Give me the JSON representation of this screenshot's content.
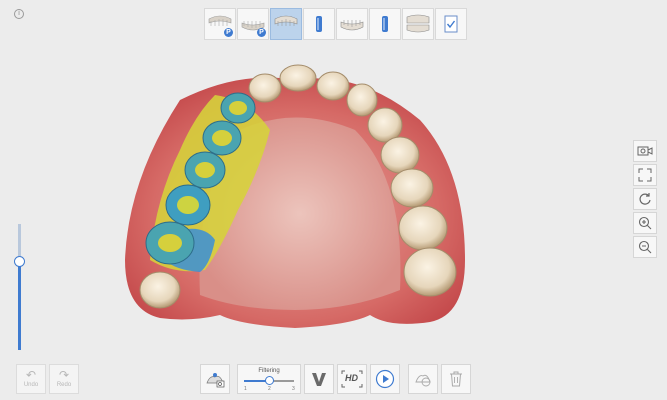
{
  "toolbar_top": {
    "stages": [
      {
        "name": "upper-jaw-prep",
        "badge": "P",
        "active": false
      },
      {
        "name": "lower-jaw-prep",
        "badge": "P",
        "active": false
      },
      {
        "name": "upper-jaw",
        "badge": "",
        "active": true
      },
      {
        "name": "upper-scanbody",
        "badge": "",
        "active": false
      },
      {
        "name": "lower-jaw",
        "badge": "",
        "active": false
      },
      {
        "name": "lower-scanbody",
        "badge": "",
        "active": false
      },
      {
        "name": "occlusion",
        "badge": "",
        "active": false
      },
      {
        "name": "review-complete",
        "badge": "",
        "active": false
      }
    ]
  },
  "right_tools": [
    "camera-icon",
    "fit-screen-icon",
    "rotate-icon",
    "zoom-in-icon",
    "zoom-out-icon"
  ],
  "left_slider": {
    "level": 0.7
  },
  "bottom": {
    "undo_label": "Undo",
    "redo_label": "Redo",
    "filtering_label": "Filtering",
    "filtering_ticks": [
      "1",
      "2",
      "3"
    ],
    "filtering_value": 2,
    "hd_label": "HD"
  },
  "colors": {
    "accent": "#3f7bd0",
    "active_stage": "#bcd3ec"
  }
}
